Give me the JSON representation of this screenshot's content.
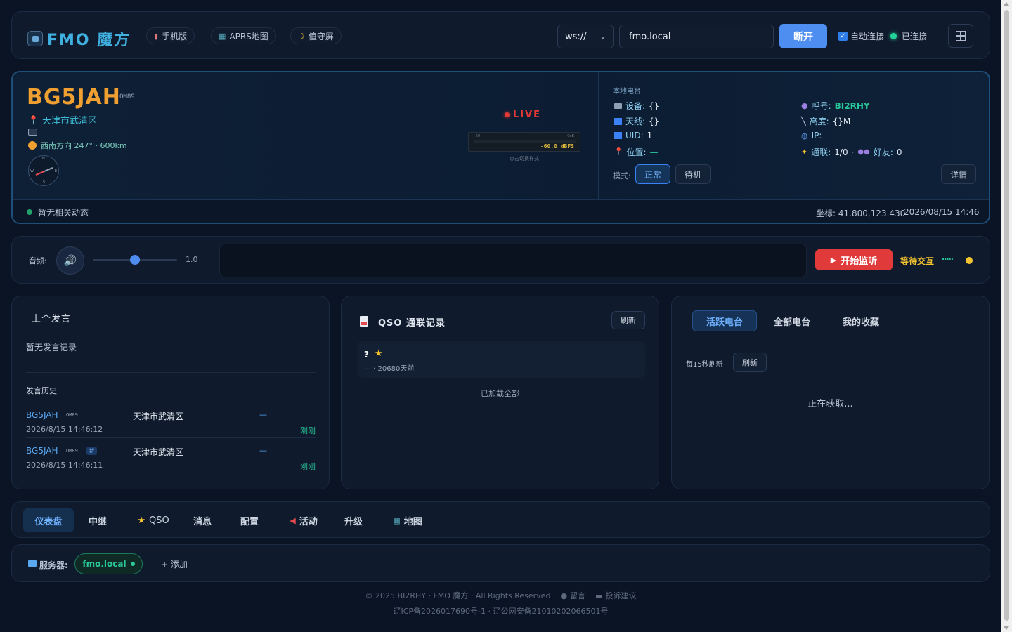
{
  "header": {
    "brand": "FMO 魔方",
    "nav": [
      {
        "icon": "phone-icon",
        "label": "手机版"
      },
      {
        "icon": "map-icon",
        "label": "APRS地图"
      },
      {
        "icon": "moon-icon",
        "label": "值守屏"
      }
    ],
    "protocol": "ws://",
    "host": "fmo.local",
    "disconnect_label": "断开",
    "auto_connect_label": "自动连接",
    "auto_connect_checked": true,
    "status_label": "已连接"
  },
  "station": {
    "callsign": "BG5JAH",
    "grid": "OM89",
    "location": "天津市武清区",
    "bearing": "西南方向 247° · 600km",
    "compass": {
      "n": "N",
      "e": "E",
      "s": "S",
      "w": "W",
      "bearing_deg": 247
    },
    "live": "LIVE",
    "meter_min": "-60",
    "meter_max": "0dB",
    "meter_value": "-60.0 dBFS",
    "meter_hint": "点击切换样式",
    "no_activity": "暂无相关动态",
    "coords": "坐标: 41.800,123.430",
    "time": "2026/08/15 14:46"
  },
  "local": {
    "title": "本地电台",
    "device_label": "设备:",
    "device_value": "{}",
    "antenna_label": "天线:",
    "antenna_value": "{}",
    "uid_label": "UID:",
    "uid_value": "1",
    "pos_label": "位置:",
    "pos_value": "—",
    "call_label": "呼号:",
    "call_value": "BI2RHY",
    "height_label": "高度:",
    "height_value": "{}M",
    "ip_label": "IP:",
    "ip_value": "—",
    "qso_label": "通联:",
    "qso_value": "1/0",
    "friends_label": "好友:",
    "friends_value": "0",
    "mode_label": "模式:",
    "mode_normal": "正常",
    "mode_standby": "待机",
    "details_label": "详情"
  },
  "audio": {
    "label": "音频:",
    "volume": 0.5,
    "volume_text": "1.0",
    "start_label": "开始监听",
    "waiting": "等待交互"
  },
  "last_speech": {
    "title": "上个发言",
    "empty": "暂无发言记录",
    "history_title": "发言历史",
    "rows": [
      {
        "call": "BG5JAH",
        "grid": "OM89",
        "badge": "",
        "location": "天津市武清区",
        "dash": "—",
        "time": "2026/8/15 14:46:12",
        "ago": "刚刚"
      },
      {
        "call": "BG5JAH",
        "grid": "OM89",
        "badge": "新",
        "location": "天津市武清区",
        "dash": "—",
        "time": "2026/8/15 14:46:11",
        "ago": "刚刚"
      }
    ]
  },
  "qso": {
    "title": "QSO 通联记录",
    "refresh": "刷新",
    "item_call": "?",
    "item_sub": "— · 20680天前",
    "loaded_all": "已加载全部"
  },
  "stations": {
    "tabs": [
      "活跃电台",
      "全部电台",
      "我的收藏"
    ],
    "auto_refresh": "每15秒刷新",
    "refresh": "刷新",
    "loading": "正在获取..."
  },
  "bottom_nav": [
    {
      "label": "仪表盘",
      "icon": ""
    },
    {
      "label": "中继",
      "icon": ""
    },
    {
      "label": "QSO",
      "icon": "star-icon"
    },
    {
      "label": "消息",
      "icon": ""
    },
    {
      "label": "配置",
      "icon": ""
    },
    {
      "label": "活动",
      "icon": "megaphone-icon"
    },
    {
      "label": "升级",
      "icon": ""
    },
    {
      "label": "地图",
      "icon": "map-icon"
    }
  ],
  "servers": {
    "label": "服务器:",
    "current": "fmo.local",
    "add": "+ 添加"
  },
  "footer": {
    "line1": "© 2025 BI2RHY · FMO 魔方 · All Rights Reserved",
    "message": "留言",
    "feedback": "投诉建议",
    "line2": "辽ICP备2026017690号-1 · 辽公网安备21010202066501号"
  },
  "colors": {
    "accent_orange": "#f0a030",
    "accent_green": "#29c79a",
    "accent_blue": "#3b82f6",
    "red": "#e53935"
  }
}
